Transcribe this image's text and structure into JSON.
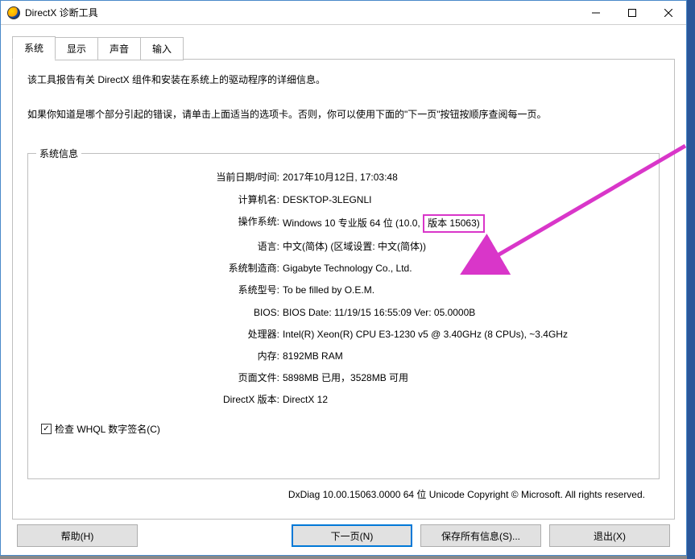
{
  "window": {
    "title": "DirectX 诊断工具"
  },
  "tabs": [
    {
      "label": "系统",
      "active": true
    },
    {
      "label": "显示",
      "active": false
    },
    {
      "label": "声音",
      "active": false
    },
    {
      "label": "输入",
      "active": false
    }
  ],
  "descriptions": {
    "line1": "该工具报告有关 DirectX 组件和安装在系统上的驱动程序的详细信息。",
    "line2": "如果你知道是哪个部分引起的错误，请单击上面适当的选项卡。否则，你可以使用下面的\"下一页\"按钮按顺序查阅每一页。"
  },
  "fieldset_title": "系统信息",
  "system_info": {
    "rows": [
      {
        "label": "当前日期/时间:",
        "value": "2017年10月12日, 17:03:48"
      },
      {
        "label": "计算机名:",
        "value": "DESKTOP-3LEGNLI"
      },
      {
        "label": "操作系统:",
        "value_prefix": "Windows 10 专业版 64 位 (10.0, ",
        "value_boxed": "版本 15063)"
      },
      {
        "label": "语言:",
        "value": "中文(简体) (区域设置: 中文(简体))"
      },
      {
        "label": "系统制造商:",
        "value": "Gigabyte Technology Co., Ltd."
      },
      {
        "label": "系统型号:",
        "value": "To be filled by O.E.M."
      },
      {
        "label": "BIOS:",
        "value": "BIOS Date: 11/19/15 16:55:09 Ver: 05.0000B"
      },
      {
        "label": "处理器:",
        "value": "Intel(R) Xeon(R) CPU E3-1230 v5 @ 3.40GHz (8 CPUs), ~3.4GHz"
      },
      {
        "label": "内存:",
        "value": "8192MB RAM"
      },
      {
        "label": "页面文件:",
        "value": "5898MB 已用，3528MB 可用"
      },
      {
        "label": "DirectX 版本:",
        "value": "DirectX 12"
      }
    ]
  },
  "whql_checkbox": {
    "checked": true,
    "label": "检查 WHQL 数字签名(C)"
  },
  "copyright": "DxDiag 10.00.15063.0000 64 位 Unicode  Copyright © Microsoft. All rights reserved.",
  "buttons": {
    "help": "帮助(H)",
    "next": "下一页(N)",
    "saveall": "保存所有信息(S)...",
    "exit": "退出(X)"
  }
}
